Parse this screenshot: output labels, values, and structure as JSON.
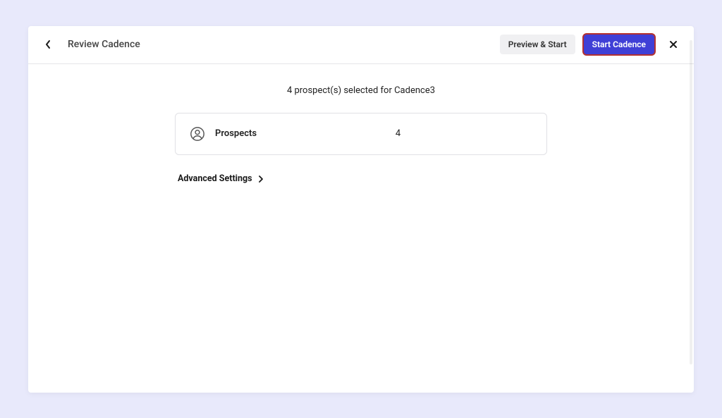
{
  "header": {
    "title": "Review Cadence",
    "preview_label": "Preview & Start",
    "start_label": "Start Cadence"
  },
  "summary": {
    "prefix": "4 prospect(s) selected for ",
    "cadence_name": "Cadence3"
  },
  "prospects_card": {
    "label": "Prospects",
    "count": "4"
  },
  "advanced": {
    "label": "Advanced Settings"
  }
}
